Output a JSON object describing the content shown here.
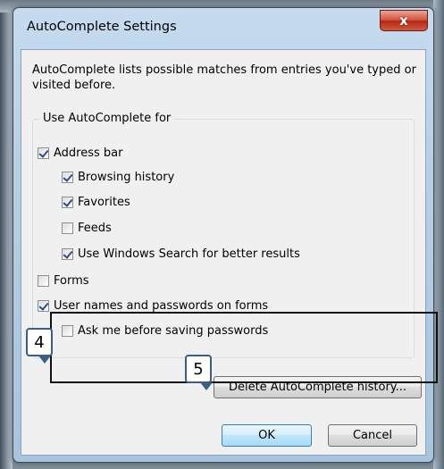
{
  "window": {
    "title": "AutoComplete Settings",
    "close_glyph": "x"
  },
  "description": "AutoComplete lists possible matches from entries you've typed or visited before.",
  "group": {
    "label": "Use AutoComplete for",
    "options": [
      {
        "label": "Address bar",
        "checked": true
      },
      {
        "label": "Browsing history",
        "checked": true
      },
      {
        "label": "Favorites",
        "checked": true
      },
      {
        "label": "Feeds",
        "checked": false
      },
      {
        "label": "Use Windows Search for better results",
        "checked": true
      },
      {
        "label": "Forms",
        "checked": false
      },
      {
        "label": "User names and passwords on forms",
        "checked": true
      },
      {
        "label": "Ask me before saving passwords",
        "checked": false
      }
    ]
  },
  "buttons": {
    "delete_history": "Delete AutoComplete history...",
    "ok": "OK",
    "cancel": "Cancel"
  },
  "annotations": {
    "marker_4": "4",
    "marker_5": "5"
  },
  "colors": {
    "callout_border": "#111111",
    "marker_border": "#3a5f86",
    "checkmark": "#2a4d8f"
  }
}
